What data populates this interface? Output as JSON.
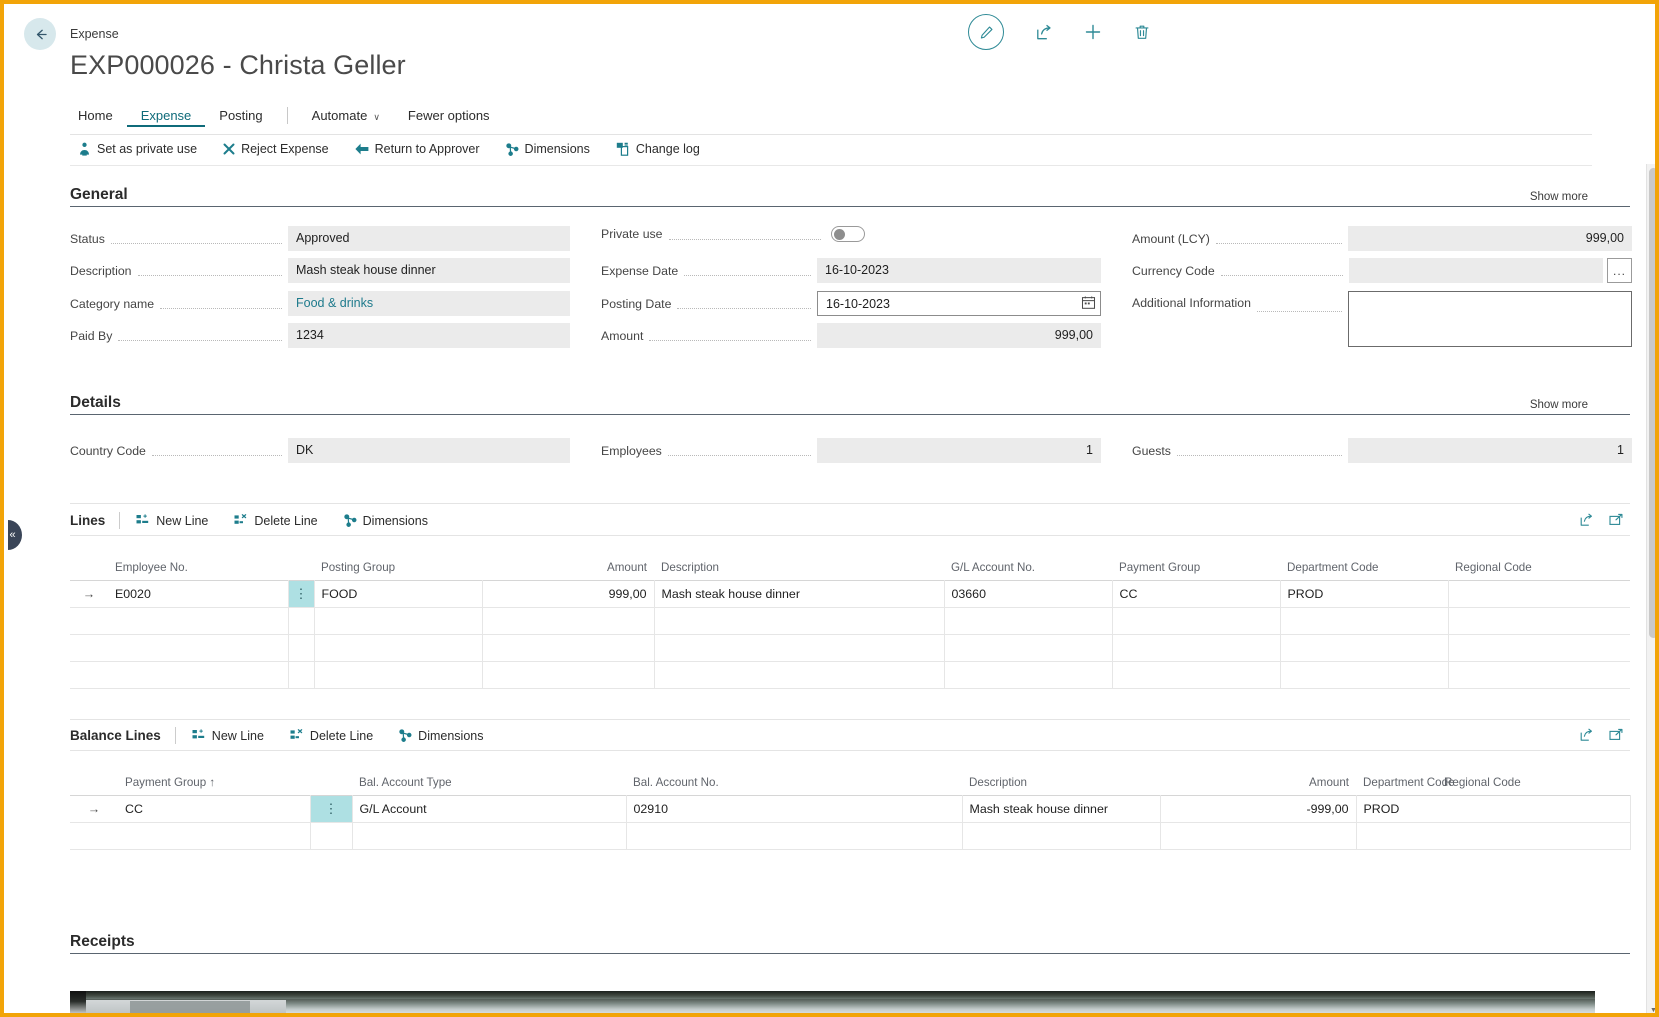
{
  "window": {
    "breadcrumb": "Expense",
    "title": "EXP000026 - Christa Geller",
    "back_icon": "back-arrow-icon",
    "top_actions": [
      {
        "name": "edit-icon",
        "label": "Edit"
      },
      {
        "name": "share-icon",
        "label": "Share"
      },
      {
        "name": "plus-icon",
        "label": "New"
      },
      {
        "name": "trash-icon",
        "label": "Delete"
      }
    ]
  },
  "tabs": [
    {
      "label": "Home",
      "active": false
    },
    {
      "label": "Expense",
      "active": true
    },
    {
      "label": "Posting",
      "active": false
    },
    {
      "label": "Automate",
      "active": false,
      "chevron": "∨"
    },
    {
      "label": "Fewer options",
      "active": false
    }
  ],
  "ribbon": [
    {
      "label": "Set as private use",
      "icon": "private-use-icon"
    },
    {
      "label": "Reject Expense",
      "icon": "x-icon"
    },
    {
      "label": "Return to Approver",
      "icon": "left-arrow-icon"
    },
    {
      "label": "Dimensions",
      "icon": "dimensions-icon"
    },
    {
      "label": "Change log",
      "icon": "change-log-icon"
    }
  ],
  "general": {
    "heading": "General",
    "show_more": "Show more",
    "left": [
      {
        "label": "Status",
        "value": "Approved",
        "style": "readonly"
      },
      {
        "label": "Description",
        "value": "Mash steak house dinner",
        "style": "readonly"
      },
      {
        "label": "Category name",
        "value": "Food & drinks",
        "style": "link"
      },
      {
        "label": "Paid By",
        "value": "1234",
        "style": "readonly"
      }
    ],
    "middle": [
      {
        "label": "Private use",
        "value": "",
        "style": "toggle",
        "toggle_on": false
      },
      {
        "label": "Expense Date",
        "value": "16-10-2023",
        "style": "readonly"
      },
      {
        "label": "Posting Date",
        "value": "16-10-2023",
        "style": "editable-date"
      },
      {
        "label": "Amount",
        "value": "999,00",
        "style": "readonly-num"
      }
    ],
    "right": [
      {
        "label": "Amount (LCY)",
        "value": "999,00",
        "style": "readonly-num"
      },
      {
        "label": "Currency Code",
        "value": "",
        "style": "readonly-lookup",
        "lookup_label": "..."
      },
      {
        "label": "Additional Information",
        "value": "",
        "style": "textarea"
      }
    ]
  },
  "details": {
    "heading": "Details",
    "show_more": "Show more",
    "fields": [
      {
        "label": "Country Code",
        "value": "DK",
        "style": "readonly"
      },
      {
        "label": "Employees",
        "value": "1",
        "style": "readonly-num"
      },
      {
        "label": "Guests",
        "value": "1",
        "style": "readonly-num"
      }
    ]
  },
  "lines": {
    "title": "Lines",
    "buttons": [
      {
        "label": "New Line",
        "icon": "new-line-icon"
      },
      {
        "label": "Delete Line",
        "icon": "delete-line-icon"
      },
      {
        "label": "Dimensions",
        "icon": "dimensions-icon"
      }
    ],
    "icons": [
      {
        "name": "share-icon"
      },
      {
        "name": "open-in-new-window-icon"
      }
    ],
    "columns": [
      {
        "label": "Employee No.",
        "align": "left"
      },
      {
        "label": "Posting Group",
        "align": "left"
      },
      {
        "label": "Amount",
        "align": "right"
      },
      {
        "label": "Description",
        "align": "left"
      },
      {
        "label": "G/L Account No.",
        "align": "left"
      },
      {
        "label": "Payment Group",
        "align": "left"
      },
      {
        "label": "Department Code",
        "align": "left"
      },
      {
        "label": "Regional Code",
        "align": "left"
      }
    ],
    "rows": [
      {
        "selected": true,
        "row_indicator": "→",
        "menu_glyph": "⋮",
        "employee_no": "E0020",
        "posting_group": "FOOD",
        "amount": "999,00",
        "description": "Mash steak house dinner",
        "gl_account_no": "03660",
        "payment_group": "CC",
        "department_code": "PROD",
        "regional_code": ""
      },
      {
        "selected": false,
        "employee_no": "",
        "posting_group": "",
        "amount": "",
        "description": "",
        "gl_account_no": "",
        "payment_group": "",
        "department_code": "",
        "regional_code": ""
      },
      {
        "selected": false,
        "employee_no": "",
        "posting_group": "",
        "amount": "",
        "description": "",
        "gl_account_no": "",
        "payment_group": "",
        "department_code": "",
        "regional_code": ""
      },
      {
        "selected": false,
        "employee_no": "",
        "posting_group": "",
        "amount": "",
        "description": "",
        "gl_account_no": "",
        "payment_group": "",
        "department_code": "",
        "regional_code": ""
      }
    ]
  },
  "balance_lines": {
    "title": "Balance Lines",
    "buttons": [
      {
        "label": "New Line",
        "icon": "new-line-icon"
      },
      {
        "label": "Delete Line",
        "icon": "delete-line-icon"
      },
      {
        "label": "Dimensions",
        "icon": "dimensions-icon"
      }
    ],
    "icons": [
      {
        "name": "share-icon"
      },
      {
        "name": "open-in-new-window-icon"
      }
    ],
    "columns": [
      {
        "label": "Payment Group ↑",
        "align": "left"
      },
      {
        "label": "Bal. Account Type",
        "align": "left"
      },
      {
        "label": "Bal. Account No.",
        "align": "left"
      },
      {
        "label": "Description",
        "align": "left"
      },
      {
        "label": "Amount",
        "align": "right"
      },
      {
        "label": "Department Code",
        "align": "left"
      },
      {
        "label": "Regional Code",
        "align": "left"
      }
    ],
    "rows": [
      {
        "selected": true,
        "row_indicator": "→",
        "menu_glyph": "⋮",
        "payment_group": "CC",
        "bal_account_type": "G/L Account",
        "bal_account_no": "02910",
        "description": "Mash steak house dinner",
        "amount": "-999,00",
        "department_code": "PROD",
        "regional_code": ""
      },
      {
        "selected": false,
        "payment_group": "",
        "bal_account_type": "",
        "bal_account_no": "",
        "description": "",
        "amount": "",
        "department_code": "",
        "regional_code": ""
      }
    ]
  },
  "receipts": {
    "heading": "Receipts",
    "image_alt": "receipt-photo-preview"
  },
  "left_panel_handle": {
    "glyph": "«"
  },
  "scrollbar": {
    "up_glyph": "▲",
    "down_glyph": "▼"
  },
  "colors": {
    "accent_teal": "#2e8a96",
    "tab_active": "#0f6b7a",
    "link": "#1e7a8c",
    "field_readonly_bg": "#ebebeb",
    "grid_menu_cell": "#aee0e3",
    "frame_orange": "#f2a408",
    "handle_navy": "#3a4558"
  }
}
